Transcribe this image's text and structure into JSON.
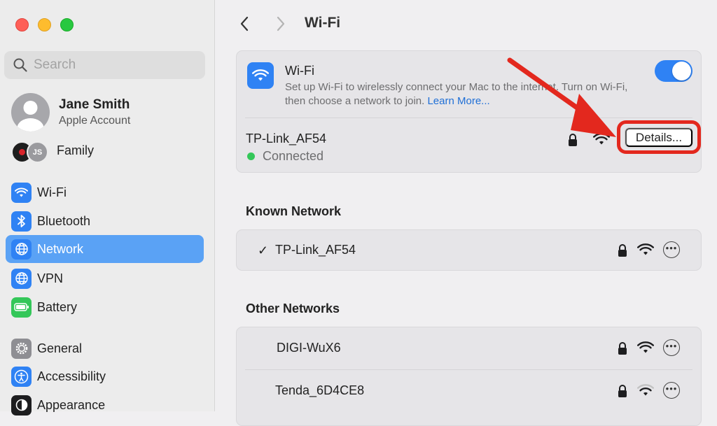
{
  "window": {
    "controls": [
      "close",
      "minimize",
      "zoom"
    ]
  },
  "sidebar": {
    "search_placeholder": "Search",
    "account": {
      "name": "Jane Smith",
      "subtitle": "Apple Account"
    },
    "family": {
      "label": "Family",
      "avatar_initials": "JS"
    },
    "items": [
      {
        "label": "Wi-Fi",
        "icon": "wifi-icon",
        "color": "#2f82f4"
      },
      {
        "label": "Bluetooth",
        "icon": "bluetooth-icon",
        "color": "#2f82f4"
      },
      {
        "label": "Network",
        "icon": "globe-icon",
        "color": "#2f82f4",
        "selected": true
      },
      {
        "label": "VPN",
        "icon": "globe-icon",
        "color": "#2f82f4"
      },
      {
        "label": "Battery",
        "icon": "battery-icon",
        "color": "#34c759"
      },
      {
        "label": "General",
        "icon": "gear-icon",
        "color": "#8e8e93"
      },
      {
        "label": "Accessibility",
        "icon": "accessibility-icon",
        "color": "#2f82f4"
      },
      {
        "label": "Appearance",
        "icon": "appearance-icon",
        "color": "#1d1d1f"
      }
    ]
  },
  "header": {
    "title": "Wi-Fi"
  },
  "wifi": {
    "title": "Wi-Fi",
    "description": "Set up Wi-Fi to wirelessly connect your Mac to the internet. Turn on Wi-Fi, then choose a network to join.",
    "learn_more": "Learn More...",
    "enabled": true,
    "current_network": {
      "name": "TP-Link_AF54",
      "status": "Connected",
      "status_color": "#34c759"
    },
    "details_label": "Details..."
  },
  "known_networks": {
    "title": "Known Network",
    "items": [
      {
        "name": "TP-Link_AF54",
        "connected": true
      }
    ]
  },
  "other_networks": {
    "title": "Other Networks",
    "items": [
      {
        "name": "DIGI-WuX6"
      },
      {
        "name": "Tenda_6D4CE8"
      }
    ]
  },
  "annotation": {
    "highlight_color": "#e3281e"
  }
}
